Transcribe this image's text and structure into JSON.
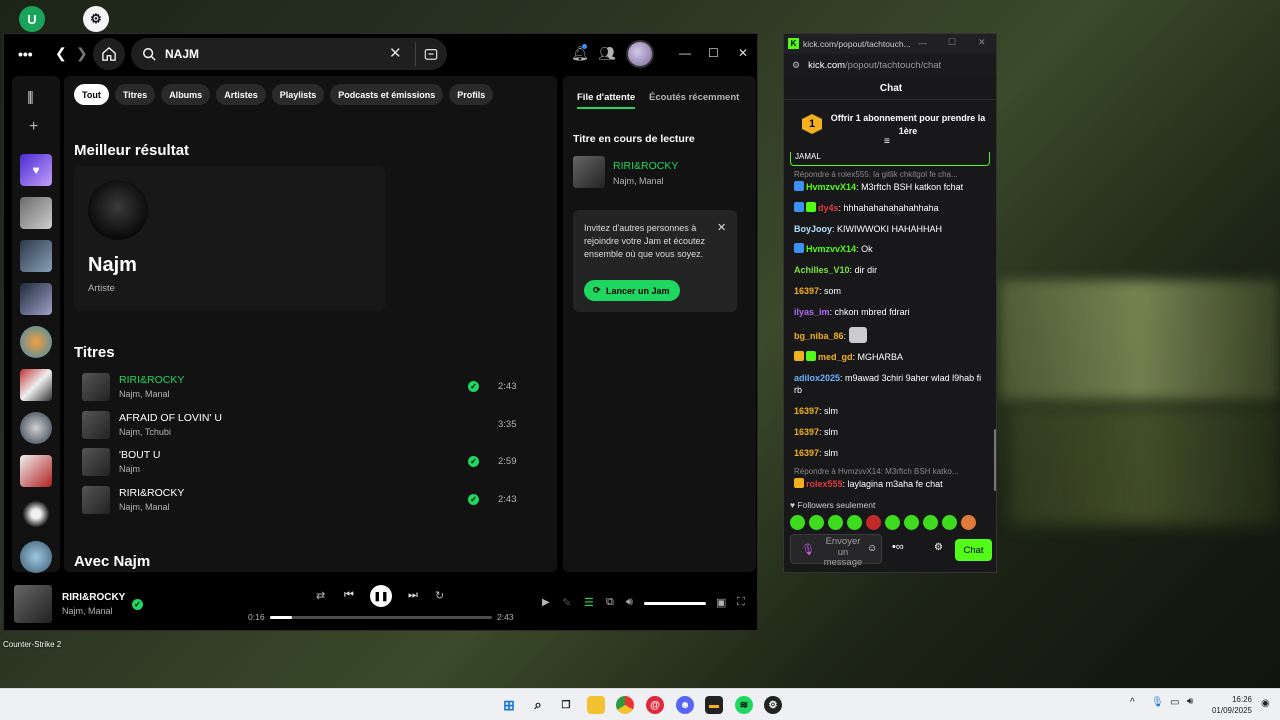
{
  "desktop": {
    "cs2_label": "Counter-Strike 2"
  },
  "spotify": {
    "search_value": "NAJM",
    "filters": [
      "Tout",
      "Titres",
      "Albums",
      "Artistes",
      "Playlists",
      "Podcasts et émissions",
      "Profils"
    ],
    "best_result_heading": "Meilleur résultat",
    "best_result": {
      "name": "Najm",
      "type": "Artiste"
    },
    "tracks_heading": "Titres",
    "tracks": [
      {
        "title": "RIRI&ROCKY",
        "artist": "Najm, Manal",
        "duration": "2:43",
        "saved": true,
        "playing": true
      },
      {
        "title": "AFRAID OF LOVIN' U",
        "artist": "Najm, Tchubi",
        "duration": "3:35",
        "saved": false,
        "playing": false
      },
      {
        "title": "'BOUT U",
        "artist": "Najm",
        "duration": "2:59",
        "saved": true,
        "playing": false
      },
      {
        "title": "RIRI&ROCKY",
        "artist": "Najm, Manal",
        "duration": "2:43",
        "saved": true,
        "playing": false
      }
    ],
    "with_heading": "Avec Najm",
    "queue": {
      "tab_queue": "File d'attente",
      "tab_recent": "Écoutés récemment",
      "now_playing_heading": "Titre en cours de lecture",
      "now_title": "RIRI&ROCKY",
      "now_artist": "Najm, Manal",
      "jam_text": "Invitez d'autres personnes à rejoindre votre Jam et écoutez ensemble où que vous soyez.",
      "jam_button": "Lancer un Jam"
    },
    "player": {
      "title": "RIRI&ROCKY",
      "artist": "Najm, Manal",
      "elapsed": "0:16",
      "total": "2:43",
      "progress": 0.1,
      "volume": 1.0
    },
    "accent": "#1ed760"
  },
  "kick": {
    "title_url": "kick.com/popout/tachtouch...",
    "address_domain": "kick.com",
    "address_path": "/popout/tachtouch/chat",
    "header": "Chat",
    "sub_badge": "1",
    "sub_text": "Offrir 1 abonnement pour prendre la 1ère",
    "pinned": "JAMAL",
    "messages": [
      {
        "reply": "Répondre à rolex555: la gitlik chkitgol fe cha..."
      },
      {
        "user": "HvmzvvX14",
        "color": "#53fc18",
        "text": "M3rftch BSH katkon fchat",
        "badges": [
          "blue"
        ]
      },
      {
        "user": "dy4s",
        "color": "#e03a3a",
        "text": "hhhahahahahahahhaha",
        "badges": [
          "blue",
          "green"
        ]
      },
      {
        "user": "BoyJooy",
        "color": "#aee1ff",
        "text": "KIWIWWOKI HAHAHHAH",
        "badges": []
      },
      {
        "user": "HvmzvvX14",
        "color": "#53fc18",
        "text": "Ok",
        "badges": [
          "blue"
        ]
      },
      {
        "user": "Achilles_V10",
        "color": "#7ee03a",
        "text": "dir dir",
        "badges": []
      },
      {
        "user": "16397",
        "color": "#f2b01e",
        "text": "som",
        "badges": []
      },
      {
        "user": "ilyas_im",
        "color": "#b06af7",
        "text": "chkon mbred fdrari",
        "badges": []
      },
      {
        "user": "bg_niba_86",
        "color": "#f2b01e",
        "text": "",
        "badges": [],
        "emote": true
      },
      {
        "user": "med_gd",
        "color": "#f2b01e",
        "text": "MGHARBA",
        "badges": [
          "gold",
          "green"
        ]
      },
      {
        "user": "adilox2025",
        "color": "#6ab0ff",
        "text": "m9awad 3chiri 9aher wlad l9hab fi rb",
        "badges": []
      },
      {
        "user": "16397",
        "color": "#f2b01e",
        "text": "slm",
        "badges": []
      },
      {
        "user": "16397",
        "color": "#f2b01e",
        "text": "slm",
        "badges": []
      },
      {
        "user": "16397",
        "color": "#f2b01e",
        "text": "slm",
        "badges": []
      },
      {
        "reply": "Répondre à HvmzvvX14: M3rftch BSH katko..."
      },
      {
        "user": "rolex555",
        "color": "#e03a3a",
        "text": "laylagina m3aha fe chat",
        "badges": [
          "gold"
        ]
      }
    ],
    "followers_only": "Followers seulement",
    "input_placeholder": "Envoyer un message",
    "send_label": "Chat",
    "accent": "#53fc18"
  },
  "taskbar": {
    "time": "16:26",
    "date": "01/09/2025"
  }
}
